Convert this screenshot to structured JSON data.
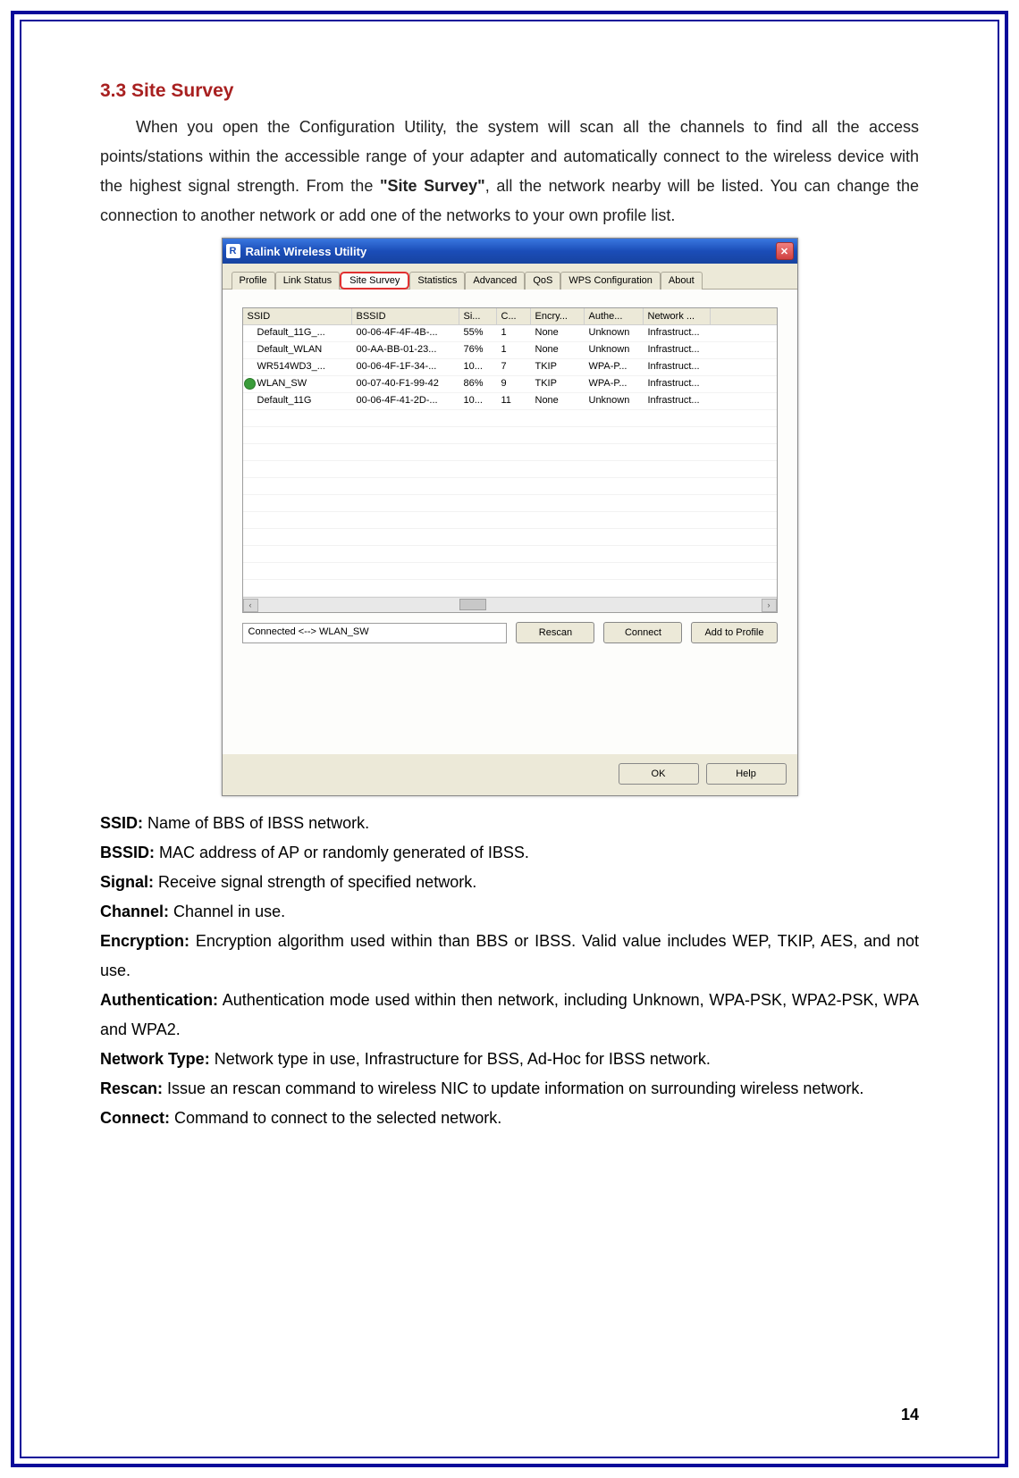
{
  "section": {
    "number": "3.3",
    "title": "Site Survey",
    "intro_prefix": "When you open the Configuration Utility, the system will scan all the channels to find all the access points/stations within the accessible range of your adapter and automatically connect to the wireless device with the highest signal strength. From the ",
    "intro_bold": "\"Site Survey\"",
    "intro_suffix": ", all the network nearby will be listed. You can change the connection to another network or add one of the networks to your own profile list."
  },
  "window": {
    "title": "Ralink Wireless Utility",
    "tabs": [
      "Profile",
      "Link Status",
      "Site Survey",
      "Statistics",
      "Advanced",
      "QoS",
      "WPS Configuration",
      "About"
    ],
    "active_tab_index": 2,
    "headers": {
      "ssid": "SSID",
      "bssid": "BSSID",
      "signal": "Si...",
      "channel": "C...",
      "encryption": "Encry...",
      "auth": "Authe...",
      "network": "Network ..."
    },
    "rows": [
      {
        "ssid": "Default_11G_...",
        "bssid": "00-06-4F-4F-4B-...",
        "signal": "55%",
        "channel": "1",
        "encryption": "None",
        "auth": "Unknown",
        "network": "Infrastruct...",
        "connected": false
      },
      {
        "ssid": "Default_WLAN",
        "bssid": "00-AA-BB-01-23...",
        "signal": "76%",
        "channel": "1",
        "encryption": "None",
        "auth": "Unknown",
        "network": "Infrastruct...",
        "connected": false
      },
      {
        "ssid": "WR514WD3_...",
        "bssid": "00-06-4F-1F-34-...",
        "signal": "10...",
        "channel": "7",
        "encryption": "TKIP",
        "auth": "WPA-P...",
        "network": "Infrastruct...",
        "connected": false
      },
      {
        "ssid": "WLAN_SW",
        "bssid": "00-07-40-F1-99-42",
        "signal": "86%",
        "channel": "9",
        "encryption": "TKIP",
        "auth": "WPA-P...",
        "network": "Infrastruct...",
        "connected": true
      },
      {
        "ssid": "Default_11G",
        "bssid": "00-06-4F-41-2D-...",
        "signal": "10...",
        "channel": "11",
        "encryption": "None",
        "auth": "Unknown",
        "network": "Infrastruct...",
        "connected": false
      }
    ],
    "status": "Connected <--> WLAN_SW",
    "buttons": {
      "rescan": "Rescan",
      "connect": "Connect",
      "add": "Add to Profile",
      "ok": "OK",
      "help": "Help"
    }
  },
  "defs": [
    {
      "label": "SSID:",
      "text": " Name of BBS of IBSS network."
    },
    {
      "label": "BSSID:",
      "text": " MAC address of AP or randomly generated of IBSS."
    },
    {
      "label": "Signal:",
      "text": " Receive signal strength of specified network."
    },
    {
      "label": "Channel:",
      "text": " Channel in use."
    },
    {
      "label": "Encryption:",
      "text": " Encryption algorithm used within than BBS or IBSS. Valid value includes WEP, TKIP, AES, and not use."
    },
    {
      "label": "Authentication:",
      "text": " Authentication mode used within then network, including Unknown, WPA-PSK, WPA2-PSK, WPA and WPA2."
    },
    {
      "label": "Network Type:",
      "text": " Network type in use, Infrastructure for BSS, Ad-Hoc for IBSS network."
    },
    {
      "label": "Rescan:",
      "text": " Issue an rescan command to wireless NIC to update information on surrounding wireless network."
    },
    {
      "label": "Connect:",
      "text": " Command to connect to the selected network."
    }
  ],
  "page_number": "14"
}
